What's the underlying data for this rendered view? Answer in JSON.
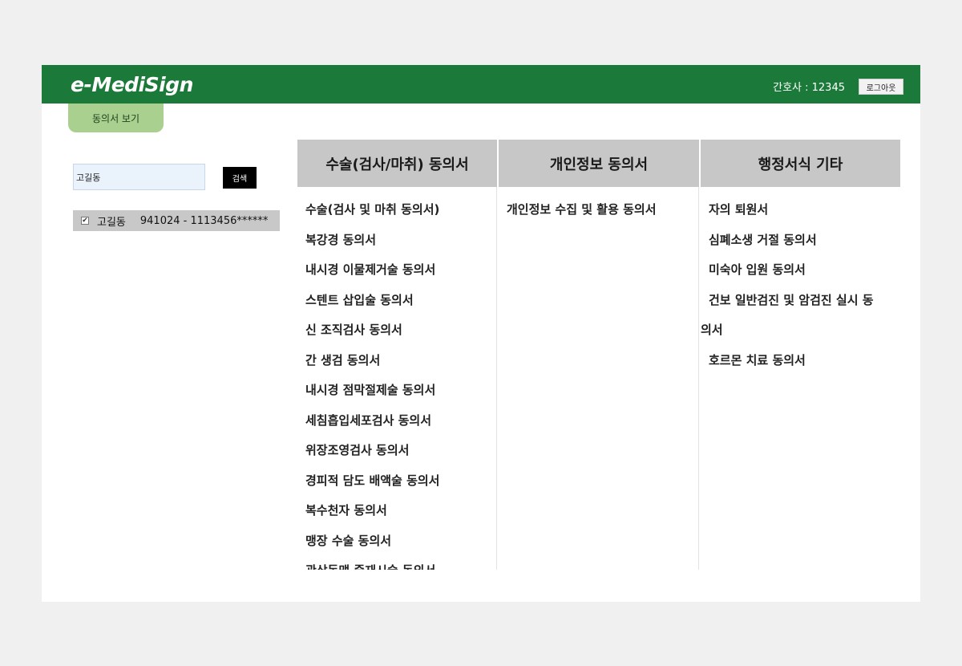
{
  "header": {
    "logo": "e-MediSign",
    "user_info": "간호사 : 12345",
    "logout_label": "로그아웃"
  },
  "tabs": [
    {
      "label": "동의서 보기"
    }
  ],
  "search": {
    "value": "고길동",
    "button_label": "검색"
  },
  "patient": {
    "checked": true,
    "name": "고길동",
    "id": "941024 - 1113456******"
  },
  "columns": [
    {
      "title": "수술(검사/마취) 동의서",
      "items": [
        "수술(검사 및 마취 동의서)",
        "복강경 동의서",
        "내시경 이물제거술 동의서",
        "스텐트 삽입술 동의서",
        "신 조직검사 동의서",
        "간 생검 동의서",
        "내시경 점막절제술 동의서",
        "세침흡입세포검사 동의서",
        "위장조영검사 동의서",
        "경피적 담도 배액술 동의서",
        "복수천자 동의서",
        "맹장 수술 동의서",
        "관상동맥 중재시술 동의서"
      ]
    },
    {
      "title": "개인정보 동의서",
      "items": [
        "개인정보 수집 및 활용 동의서"
      ]
    },
    {
      "title": "행정서식 기타",
      "items": [
        "자의 퇴원서",
        "심폐소생 거절 동의서",
        "미숙아 입원 동의서",
        "건보 일반검진 및 암검진 실시 동의서",
        "호르몬 치료 동의서"
      ]
    }
  ]
}
